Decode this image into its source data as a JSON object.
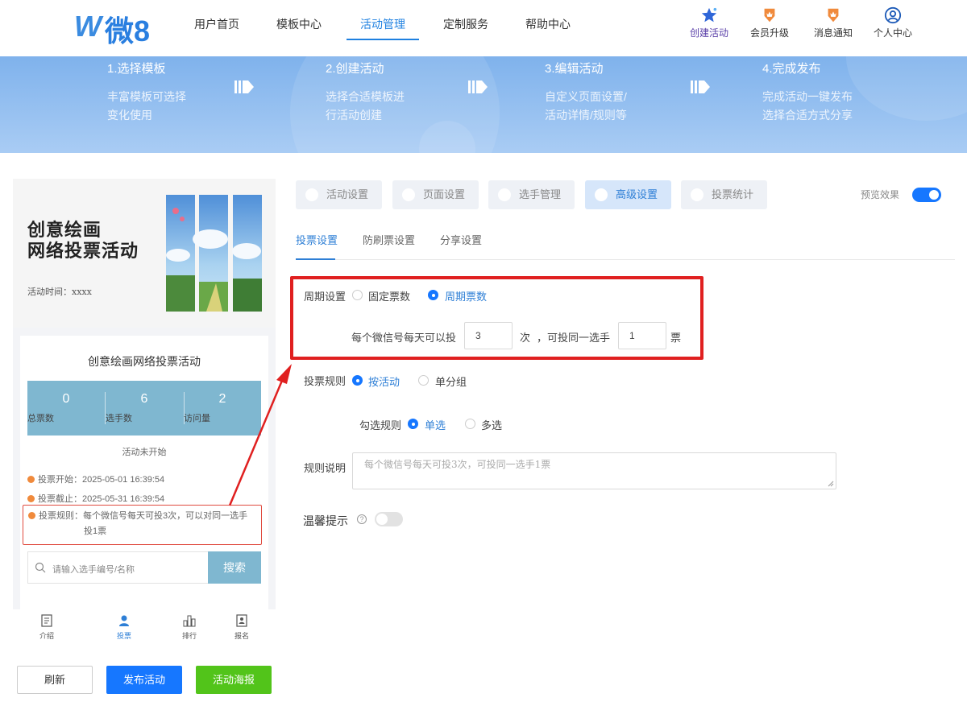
{
  "header": {
    "logo_text": "微8",
    "nav": [
      "用户首页",
      "模板中心",
      "活动管理",
      "定制服务",
      "帮助中心"
    ],
    "active_nav": "活动管理",
    "actions": [
      {
        "label": "创建活动",
        "icon": "star-icon"
      },
      {
        "label": "会员升级",
        "icon": "crown-badge-icon"
      },
      {
        "label": "消息通知",
        "icon": "bell-badge-icon"
      },
      {
        "label": "个人中心",
        "icon": "user-circle-icon"
      }
    ]
  },
  "steps": [
    {
      "title": "1.选择模板",
      "line1": "丰富模板可选择",
      "line2": "变化使用"
    },
    {
      "title": "2.创建活动",
      "line1": "选择合适模板进",
      "line2": "行活动创建"
    },
    {
      "title": "3.编辑活动",
      "line1": "自定义页面设置/",
      "line2": "活动详情/规则等"
    },
    {
      "title": "4.完成发布",
      "line1": "完成活动一键发布",
      "line2": "选择合适方式分享"
    }
  ],
  "preview": {
    "cover_title_1": "创意绘画",
    "cover_title_2": "网络投票活动",
    "cover_time": "活动时间：xxxx",
    "card_title": "创意绘画网络投票活动",
    "stats": [
      {
        "value": "0",
        "label": "总票数"
      },
      {
        "value": "6",
        "label": "选手数"
      },
      {
        "value": "2",
        "label": "访问量"
      }
    ],
    "status": "活动未开始",
    "vote_start": "投票开始：2025-05-01 16:39:54",
    "vote_end": "投票截止：2025-05-31 16:39:54",
    "vote_rule_1": "投票规则：每个微信号每天可投3次，可以对同一选手",
    "vote_rule_2": "投1票",
    "search_placeholder": "请输入选手编号/名称",
    "search_button": "搜索",
    "tabs": [
      {
        "label": "介绍",
        "icon": "document-icon"
      },
      {
        "label": "投票",
        "icon": "person-icon"
      },
      {
        "label": "排行",
        "icon": "bar-chart-icon"
      },
      {
        "label": "报名",
        "icon": "id-card-icon"
      }
    ],
    "active_tab": "投票"
  },
  "buttons": {
    "refresh": "刷新",
    "publish": "发布活动",
    "poster": "活动海报"
  },
  "settings": {
    "top_tabs": [
      "活动设置",
      "页面设置",
      "选手管理",
      "高级设置",
      "投票统计"
    ],
    "active_top_tab": "高级设置",
    "preview_label": "预览效果",
    "preview_on": true,
    "sub_tabs": [
      "投票设置",
      "防刷票设置",
      "分享设置"
    ],
    "active_sub_tab": "投票设置",
    "period": {
      "label": "周期设置",
      "options": [
        "固定票数",
        "周期票数"
      ],
      "selected": "周期票数",
      "prefix": "每个微信号每天可以投",
      "times_value": "3",
      "times_unit": "次",
      "middle": "，可投同一选手",
      "votes_value": "1",
      "votes_unit": "票"
    },
    "vote_rule": {
      "label": "投票规则",
      "options": [
        "按活动",
        "单分组"
      ],
      "selected": "按活动"
    },
    "check_rule": {
      "label": "勾选规则",
      "options": [
        "单选",
        "多选"
      ],
      "selected": "单选"
    },
    "rule_desc": {
      "label": "规则说明",
      "placeholder": "每个微信号每天可投3次，可投同一选手1票"
    },
    "tip": {
      "label": "温馨提示",
      "help": "?",
      "enabled": false
    }
  },
  "colors": {
    "primary": "#1677ff",
    "highlight": "#e02020",
    "stats_bg": "#7fb7d0",
    "poster": "#52c41a"
  }
}
